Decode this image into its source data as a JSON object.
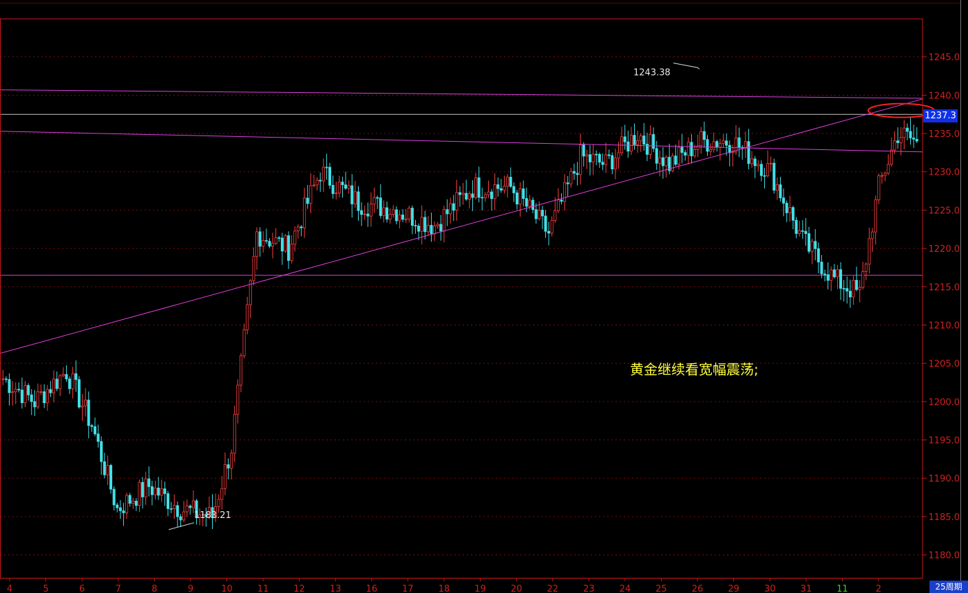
{
  "chart_data": {
    "type": "candlestick",
    "title": "",
    "ylim": [
      1177,
      1250
    ],
    "y_ticks": [
      1180.0,
      1185.0,
      1190.0,
      1195.0,
      1200.0,
      1205.0,
      1210.0,
      1215.0,
      1220.0,
      1225.0,
      1230.0,
      1235.0,
      1240.0,
      1245.0
    ],
    "x_date_labels": [
      "4",
      "5",
      "6",
      "7",
      "8",
      "9",
      "10",
      "11",
      "12",
      "13",
      "16",
      "17",
      "18",
      "19",
      "20",
      "22",
      "23",
      "24",
      "25",
      "26",
      "29",
      "30",
      "31",
      "11",
      "2"
    ],
    "highlight_labels": [
      "11"
    ],
    "current_price": "1237.3",
    "period_label": "25周期",
    "annotations": {
      "high_label": "1243.38",
      "low_label": "1183.21",
      "note": "黄金继续看宽幅震荡;"
    },
    "horizontal_levels": [
      1237.5,
      1216.5
    ],
    "anchors": [
      {
        "i": 0,
        "p": 1203
      },
      {
        "i": 10,
        "p": 1200
      },
      {
        "i": 20,
        "p": 1204
      },
      {
        "i": 28,
        "p": 1197
      },
      {
        "i": 36,
        "p": 1186
      },
      {
        "i": 46,
        "p": 1189
      },
      {
        "i": 56,
        "p": 1186
      },
      {
        "i": 66,
        "p": 1185
      },
      {
        "i": 72,
        "p": 1194
      },
      {
        "i": 80,
        "p": 1222
      },
      {
        "i": 90,
        "p": 1220
      },
      {
        "i": 100,
        "p": 1230
      },
      {
        "i": 112,
        "p": 1226
      },
      {
        "i": 124,
        "p": 1225
      },
      {
        "i": 136,
        "p": 1223
      },
      {
        "i": 148,
        "p": 1228
      },
      {
        "i": 160,
        "p": 1228
      },
      {
        "i": 172,
        "p": 1222
      },
      {
        "i": 182,
        "p": 1232
      },
      {
        "i": 190,
        "p": 1231
      },
      {
        "i": 200,
        "p": 1235
      },
      {
        "i": 210,
        "p": 1231
      },
      {
        "i": 220,
        "p": 1234
      },
      {
        "i": 230,
        "p": 1234
      },
      {
        "i": 242,
        "p": 1230
      },
      {
        "i": 252,
        "p": 1221
      },
      {
        "i": 262,
        "p": 1216
      },
      {
        "i": 270,
        "p": 1214
      },
      {
        "i": 276,
        "p": 1228
      },
      {
        "i": 282,
        "p": 1235
      },
      {
        "i": 288,
        "p": 1234
      }
    ],
    "colors": {
      "up": "#ff4040",
      "down": "#40e0e8",
      "grid": "#7a1010",
      "axis": "#cc1818",
      "trend": "#e040e0",
      "level": "#c8c8c8",
      "ellipse": "#ff2020"
    }
  }
}
